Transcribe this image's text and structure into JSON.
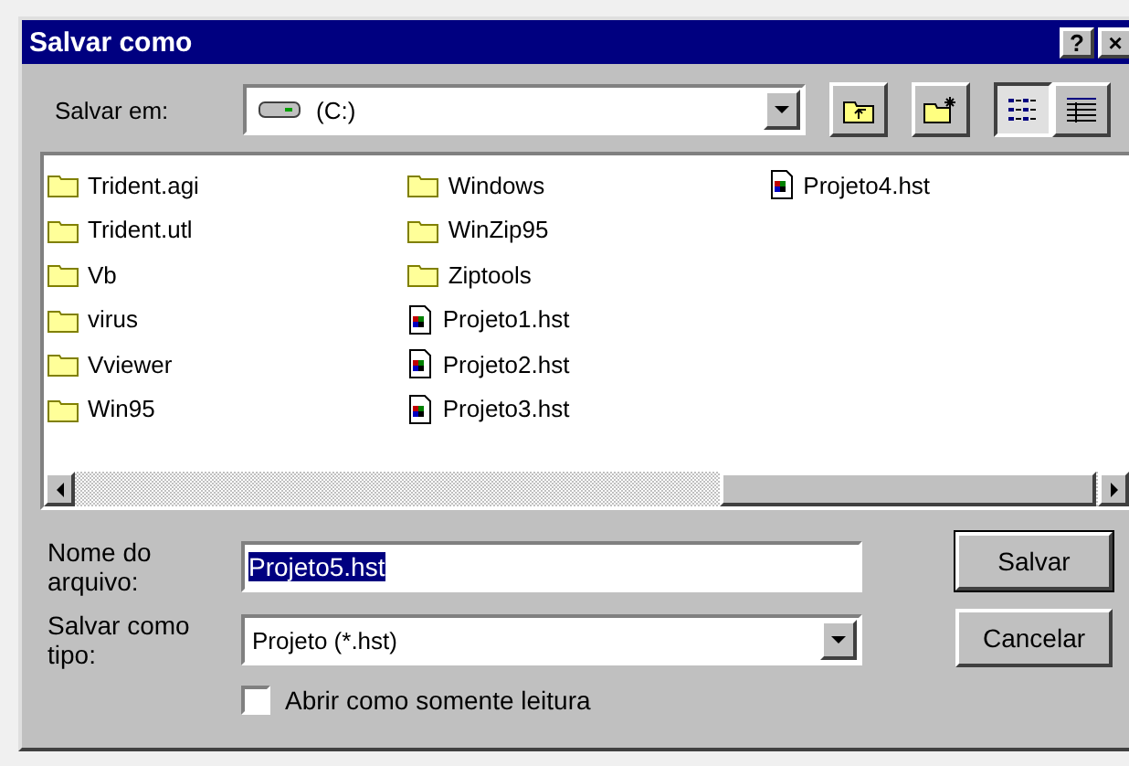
{
  "window": {
    "title": "Salvar como",
    "title_buttons": [
      "?",
      "×"
    ]
  },
  "save_in": {
    "label": "Salvar em:",
    "value": "(C:)"
  },
  "view_buttons": [
    {
      "kind": "list",
      "selected": true
    },
    {
      "kind": "details",
      "selected": false
    }
  ],
  "files": [
    {
      "name": "Trident.agi",
      "kind": "folder"
    },
    {
      "name": "Trident.utl",
      "kind": "folder"
    },
    {
      "name": "Vb",
      "kind": "folder"
    },
    {
      "name": "virus",
      "kind": "folder"
    },
    {
      "name": "Vviewer",
      "kind": "folder"
    },
    {
      "name": "Win95",
      "kind": "folder"
    },
    {
      "name": "Windows",
      "kind": "folder"
    },
    {
      "name": "WinZip95",
      "kind": "folder"
    },
    {
      "name": "Ziptools",
      "kind": "folder"
    },
    {
      "name": "Projeto1.hst",
      "kind": "file"
    },
    {
      "name": "Projeto2.hst",
      "kind": "file"
    },
    {
      "name": "Projeto3.hst",
      "kind": "file"
    },
    {
      "name": "Projeto4.hst",
      "kind": "file"
    }
  ],
  "file_name": {
    "label": "Nome do arquivo:",
    "value": "Projeto5.hst"
  },
  "file_type": {
    "label": "Salvar como tipo:",
    "value": "Projeto (*.hst)"
  },
  "read_only": {
    "label": "Abrir como somente leitura",
    "checked": false
  },
  "buttons": [
    "Salvar",
    "Cancelar"
  ]
}
